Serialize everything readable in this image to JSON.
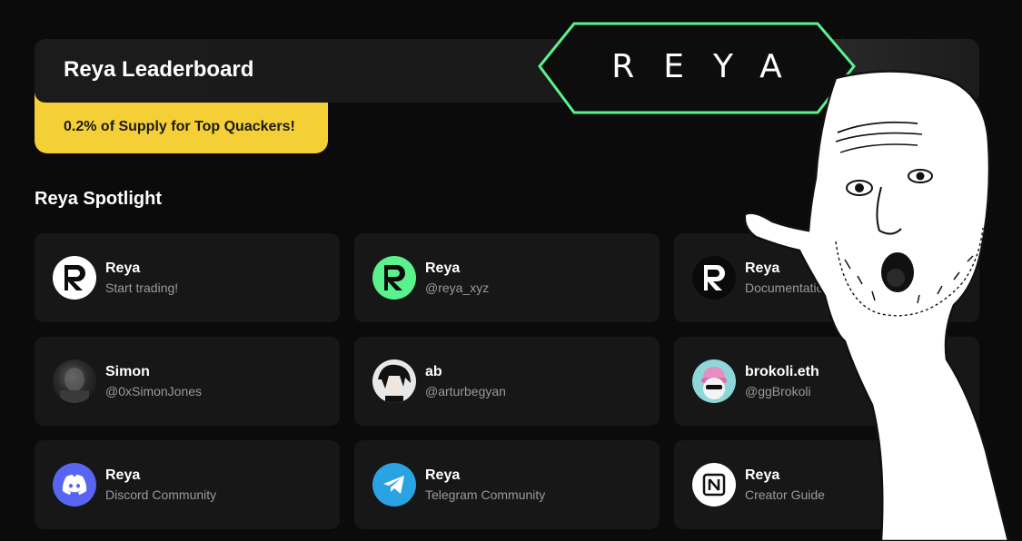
{
  "header": {
    "title": "Reya Leaderboard"
  },
  "promo": {
    "text": "0.2% of Supply for Top Quackers!"
  },
  "logo": {
    "text": "REYA"
  },
  "spotlight": {
    "title": "Reya Spotlight",
    "cards": [
      {
        "name": "Reya",
        "sub": "Start trading!",
        "avatar": "reya-logo-white"
      },
      {
        "name": "Reya",
        "sub": "@reya_xyz",
        "avatar": "reya-logo-green"
      },
      {
        "name": "Reya",
        "sub": "Documentation",
        "avatar": "reya-logo-black"
      },
      {
        "name": "Simon",
        "sub": "@0xSimonJones",
        "avatar": "profile-photo"
      },
      {
        "name": "ab",
        "sub": "@arturbegyan",
        "avatar": "profile-photo"
      },
      {
        "name": "brokoli.eth",
        "sub": "@ggBrokoli",
        "avatar": "profile-photo"
      },
      {
        "name": "Reya",
        "sub": "Discord Community",
        "avatar": "discord-icon"
      },
      {
        "name": "Reya",
        "sub": "Telegram Community",
        "avatar": "telegram-icon"
      },
      {
        "name": "Reya",
        "sub": "Creator Guide",
        "avatar": "notion-icon"
      }
    ]
  },
  "colors": {
    "accent_yellow": "#f5cf36",
    "accent_green": "#5af28d",
    "card_bg": "#171717"
  }
}
